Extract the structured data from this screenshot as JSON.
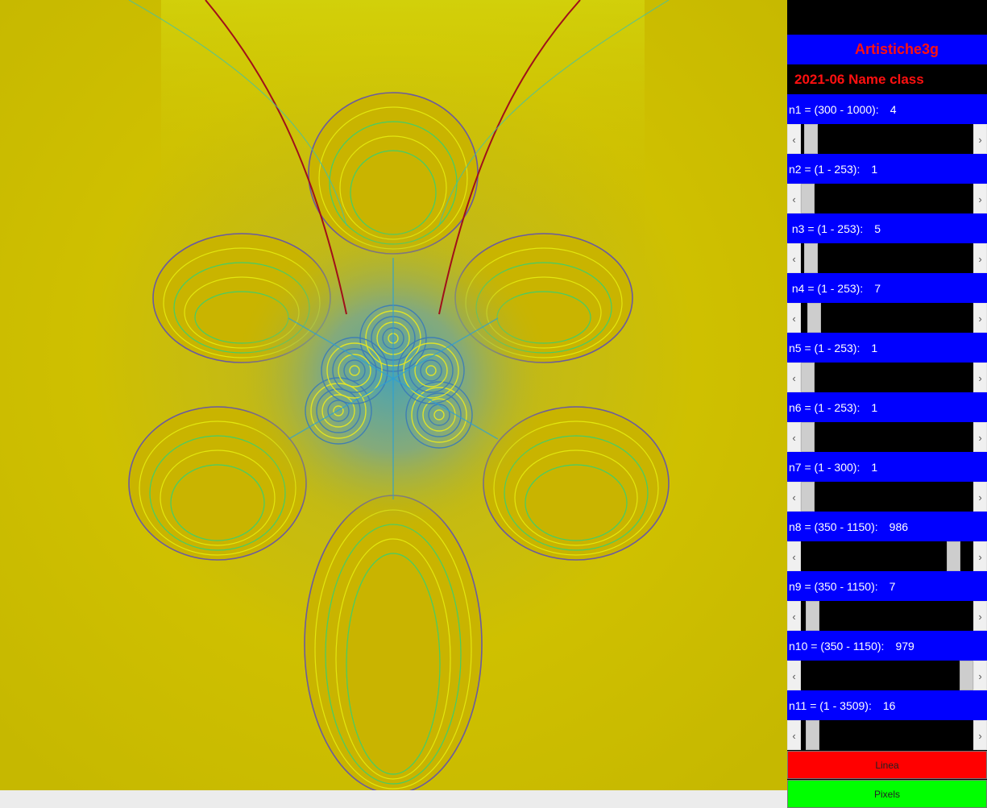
{
  "panel": {
    "title": "Artistiche3g",
    "subtitle": "2021-06  Name class",
    "buttons": {
      "linea": "Linea",
      "pixels": "Pixels"
    },
    "params": [
      {
        "label": "n1 = (300 - 1000):",
        "value": "4",
        "min": 300,
        "max": 1000
      },
      {
        "label": "n2 = (1 - 253):",
        "value": "1",
        "min": 1,
        "max": 253
      },
      {
        "label": " n3 = (1 - 253):",
        "value": "5",
        "min": 1,
        "max": 253
      },
      {
        "label": " n4 = (1 - 253):",
        "value": "7",
        "min": 1,
        "max": 253
      },
      {
        "label": "n5 = (1 - 253):",
        "value": "1",
        "min": 1,
        "max": 253
      },
      {
        "label": "n6 = (1 - 253):",
        "value": "1",
        "min": 1,
        "max": 253
      },
      {
        "label": "n7 = (1 - 300):",
        "value": "1",
        "min": 1,
        "max": 300
      },
      {
        "label": "n8 = (350 - 1150):",
        "value": "986",
        "min": 350,
        "max": 1150
      },
      {
        "label": "n9 = (350 - 1150):",
        "value": "7",
        "min": 350,
        "max": 1150
      },
      {
        "label": "n10 = (350 - 1150):",
        "value": "979",
        "min": 350,
        "max": 1150
      },
      {
        "label": "n11 = (1 - 3509):",
        "value": "16",
        "min": 1,
        "max": 3509
      }
    ],
    "slider_positions": [
      0.02,
      0.0,
      0.02,
      0.04,
      0.0,
      0.0,
      0.0,
      0.92,
      0.03,
      1.0,
      0.03
    ]
  },
  "colors": {
    "background_yellow": "#c8b400",
    "panel_blue": "#0000ff",
    "title_red": "#ff1010",
    "linea_red": "#ff0000",
    "pixels_green": "#00ff00"
  }
}
